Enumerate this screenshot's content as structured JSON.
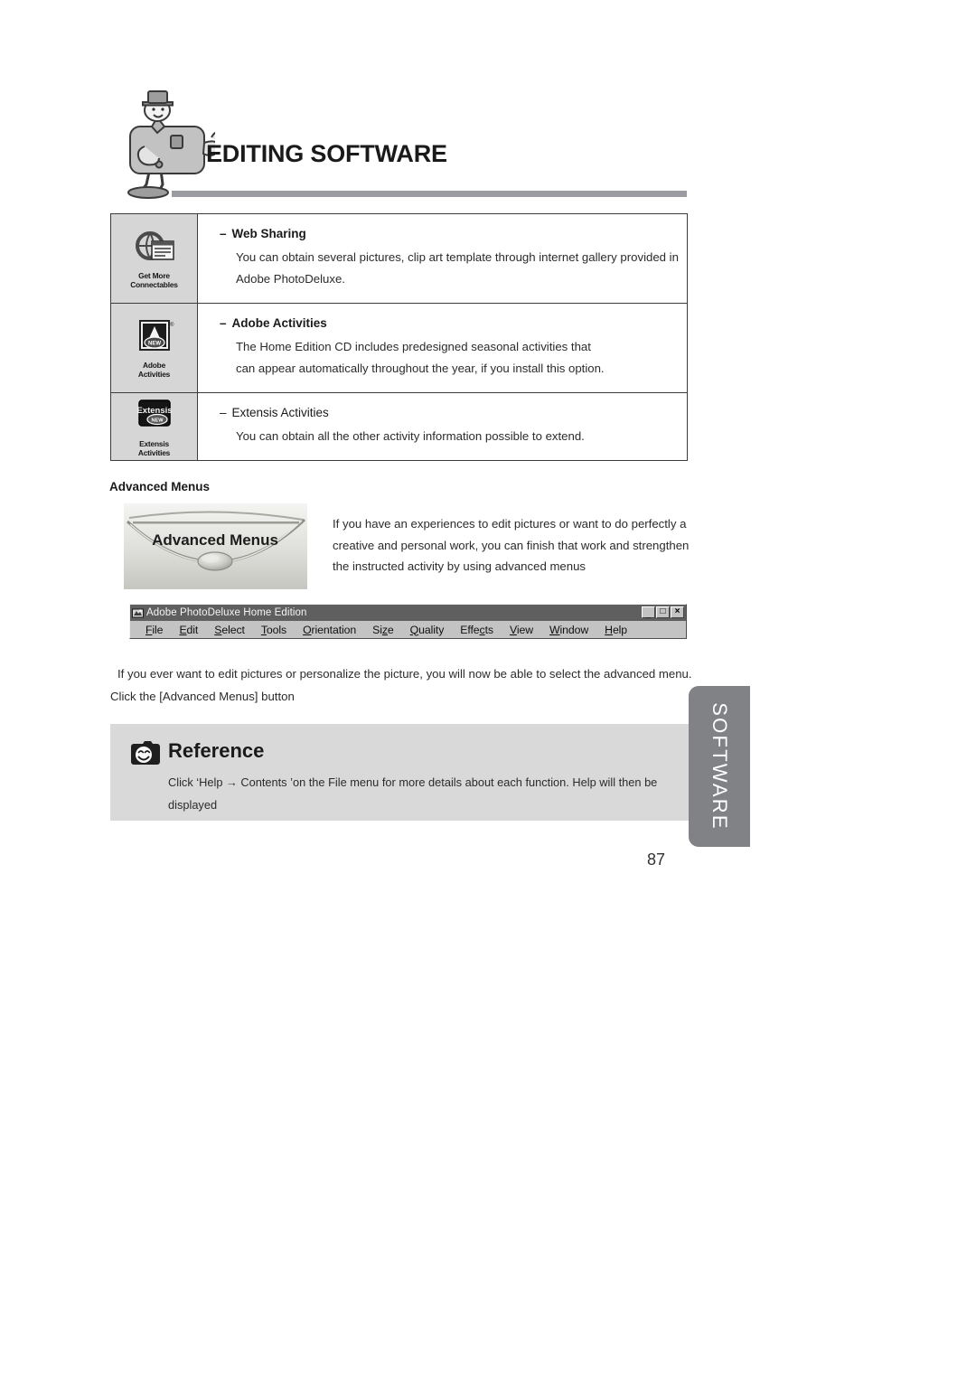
{
  "header": {
    "title": "EDITING SOFTWARE",
    "mascot_icon": "camera-mascot-icon"
  },
  "feature_table": {
    "rows": [
      {
        "icon_name": "get-more-connectables-icon",
        "icon_caption_line1": "Get More",
        "icon_caption_line2": "Connectables",
        "dash": "–",
        "heading": "Web Sharing",
        "heading_bold": true,
        "lines": [
          "You can obtain several pictures, clip art template through internet gallery provided in",
          "Adobe PhotoDeluxe."
        ]
      },
      {
        "icon_name": "adobe-activities-icon",
        "icon_caption_line1": "Adobe",
        "icon_caption_line2": "Activities",
        "dash": "–",
        "heading": "Adobe Activities",
        "heading_bold": true,
        "lines": [
          "The Home Edition CD includes predesigned seasonal activities that",
          "can appear automatically throughout the year, if you install this option."
        ]
      },
      {
        "icon_name": "extensis-activities-icon",
        "icon_caption_line1": "Extensis",
        "icon_caption_line2": "Activities",
        "dash": "–",
        "heading": "Extensis Activities",
        "heading_bold": false,
        "lines": [
          "You can obtain all the other activity information possible to extend."
        ]
      }
    ]
  },
  "advanced_menus": {
    "heading": "Advanced Menus",
    "button_image_label": "Advanced Menus",
    "paragraph_lines": [
      "If you have an experiences to edit pictures or want to do perfectly a",
      "creative and personal work, you can finish that work and strengthen",
      "the instructed activity by using advanced menus"
    ]
  },
  "app_window": {
    "title": "Adobe PhotoDeluxe Home Edition",
    "title_icon": "photodeluxe-app-icon",
    "window_buttons": [
      {
        "name": "minimize-button",
        "glyph": "_"
      },
      {
        "name": "maximize-button",
        "glyph": "□"
      },
      {
        "name": "close-button",
        "glyph": "×"
      }
    ],
    "menus": [
      {
        "pre": "",
        "key": "F",
        "post": "ile"
      },
      {
        "pre": "",
        "key": "E",
        "post": "dit"
      },
      {
        "pre": "",
        "key": "S",
        "post": "elect"
      },
      {
        "pre": "",
        "key": "T",
        "post": "ools"
      },
      {
        "pre": "",
        "key": "O",
        "post": "rientation"
      },
      {
        "pre": "Si",
        "key": "z",
        "post": "e"
      },
      {
        "pre": "",
        "key": "Q",
        "post": "uality"
      },
      {
        "pre": "Effe",
        "key": "c",
        "post": "ts"
      },
      {
        "pre": "",
        "key": "V",
        "post": "iew"
      },
      {
        "pre": "",
        "key": "W",
        "post": "indow"
      },
      {
        "pre": "",
        "key": "H",
        "post": "elp"
      }
    ]
  },
  "body_paragraph": {
    "lines": [
      "If you ever want to edit pictures or personalize the picture, you will now be able to select the advanced  menu.",
      "Click the [Advanced Menus] button"
    ]
  },
  "reference": {
    "icon_name": "camera-smile-icon",
    "title": "Reference",
    "lines": [
      "Click ‘Help → Contents ’on the File menu for more details about each function. Help will then be",
      "displayed"
    ]
  },
  "side_tab": {
    "label": "SOFTWARE"
  },
  "page_number": "87",
  "colors": {
    "rule": "#9a9ca1",
    "side_tab": "#808286",
    "reference_bg": "#d9d9d9",
    "icon_cell_bg": "#d6d6d6",
    "titlebar": "#5f5f5f",
    "menubar": "#c3c3c3"
  }
}
